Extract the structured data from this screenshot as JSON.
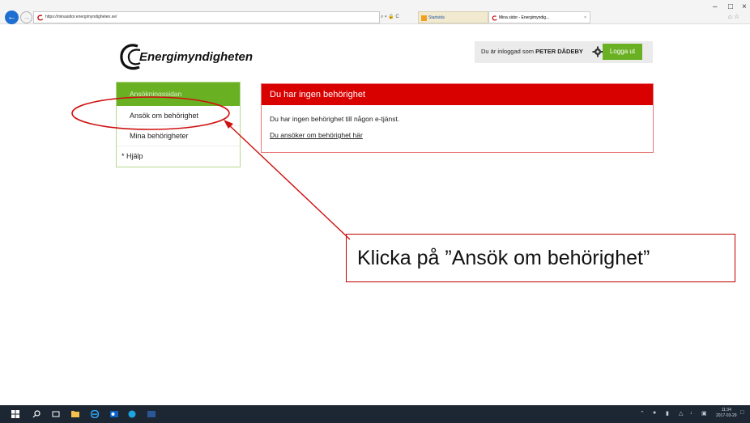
{
  "browser": {
    "address_url": "https://minasidor.energimyndigheten.se/",
    "address_tools": "⌕ ▾ 🔒 C",
    "tabs": [
      {
        "label": "Startsida"
      },
      {
        "label": "Mina sidor - Energimyndig...",
        "close": "×"
      }
    ],
    "window_controls": {
      "minimize": "–",
      "maximize": "□",
      "close": "×"
    },
    "home_star": "⌂ ☆"
  },
  "header": {
    "logo_text": "Energimyndigheten",
    "login_prefix": "Du är inloggad som ",
    "user_name": "PETER DÅDEBY",
    "logout_label": "Logga ut"
  },
  "sidebar": {
    "heading": "Ansökningssidan",
    "items": [
      {
        "label": "Ansök om behörighet"
      },
      {
        "label": "Mina behörigheter"
      },
      {
        "label": "* Hjälp"
      }
    ]
  },
  "main": {
    "panel_title": "Du har ingen behörighet",
    "panel_text": "Du har ingen behörighet till någon e-tjänst.",
    "panel_link": "Du ansöker om behörighet här"
  },
  "annotation": {
    "callout_text": "Klicka på ”Ansök om behörighet”"
  },
  "taskbar": {
    "time": "11:34",
    "date": "2017-03-29"
  },
  "colors": {
    "brand_green": "#6ab023",
    "alert_red": "#d90000",
    "annotation_red": "#d01010"
  }
}
